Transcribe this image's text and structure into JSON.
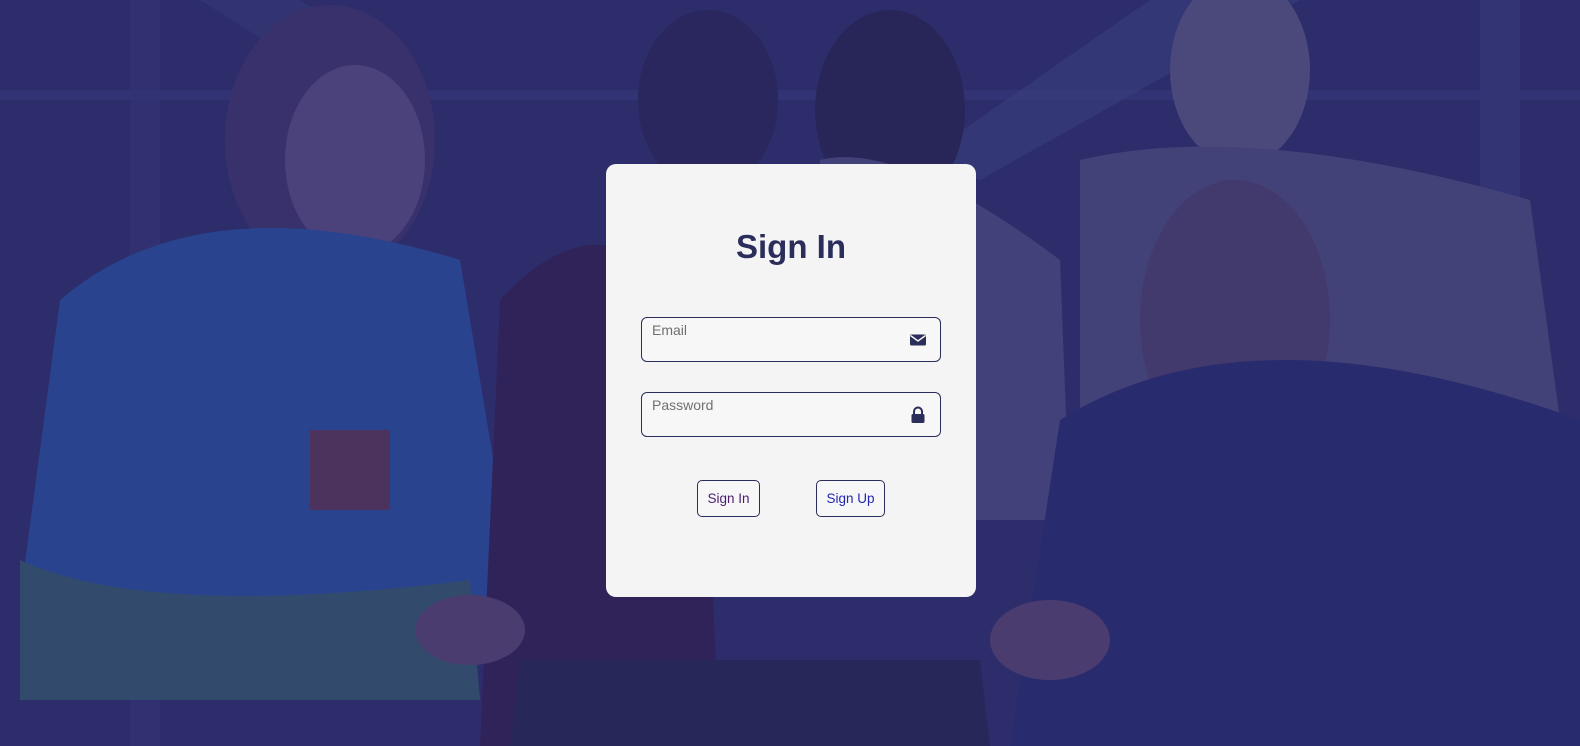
{
  "form": {
    "title": "Sign In",
    "email_placeholder": "Email",
    "password_placeholder": "Password",
    "email_value": "",
    "password_value": "",
    "email_icon": "envelope-icon",
    "password_icon": "lock-icon",
    "signin_label": "Sign In",
    "signup_label": "Sign Up"
  },
  "colors": {
    "overlay": "#26246e",
    "card_background": "#f4f4f5",
    "title": "#2b2d5a",
    "border": "#2b2d5a",
    "signin_text": "#4a1d6e",
    "signup_text": "#2228b0"
  },
  "background": {
    "image": "group of people gathered around a laptop, cheering, tinted blue"
  }
}
